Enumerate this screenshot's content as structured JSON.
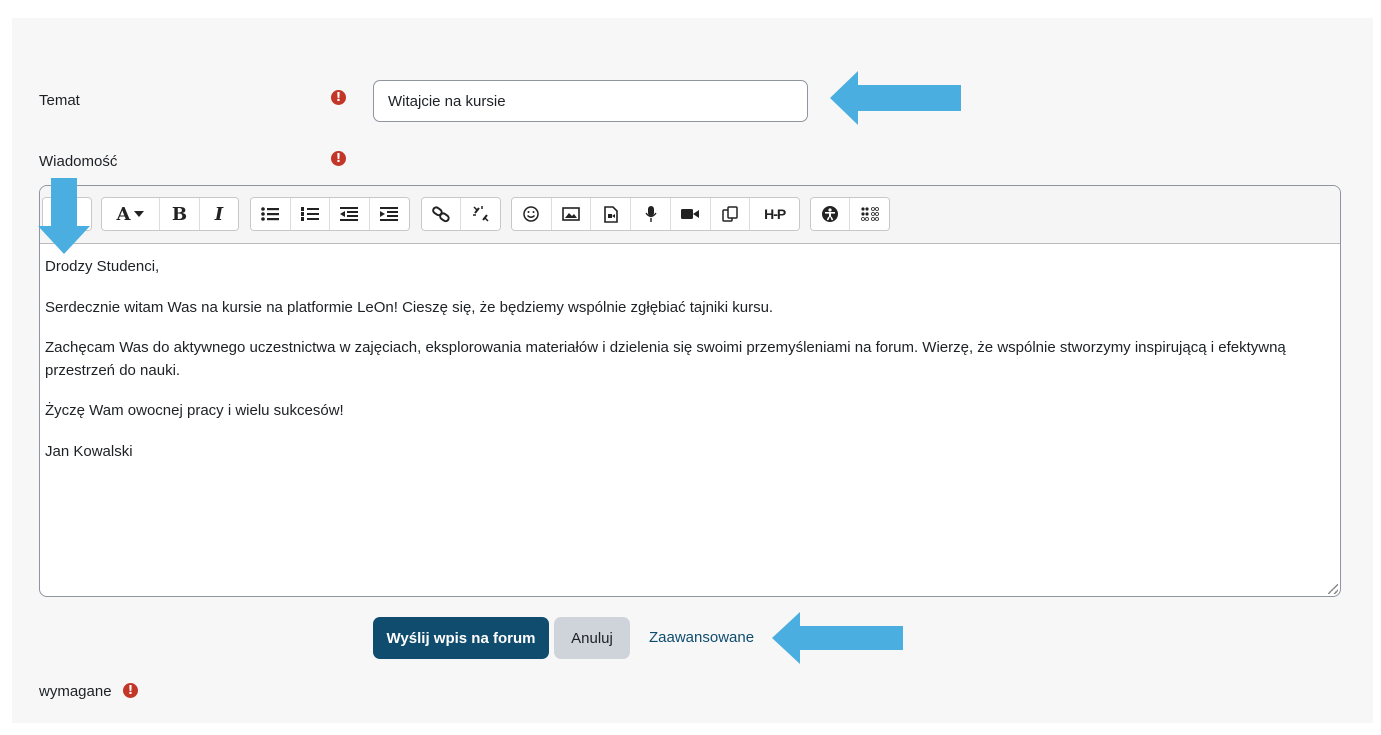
{
  "form": {
    "subject_label": "Temat",
    "subject_value": "Witajcie na kursie",
    "message_label": "Wiadomość",
    "required_label": "wymagane",
    "required_icon": "exclamation-circle-icon",
    "required_color": "#c23728"
  },
  "toolbar": {
    "groups": [
      [
        "collapse-toggle"
      ],
      [
        "font-style-dropdown",
        "bold",
        "italic"
      ],
      [
        "unordered-list",
        "ordered-list",
        "outdent",
        "indent"
      ],
      [
        "link",
        "unlink"
      ],
      [
        "emoji",
        "image",
        "media",
        "record-audio",
        "record-video",
        "manage-files",
        "h5p"
      ],
      [
        "accessibility-checker",
        "screenreader-helper"
      ]
    ],
    "font_style_label": "A",
    "bold_label": "B",
    "italic_label": "I",
    "h5p_label": "H-P"
  },
  "message": {
    "paragraphs": [
      "Drodzy Studenci,",
      "Serdecznie witam Was na kursie na platformie LeOn! Cieszę się, że będziemy wspólnie zgłębiać tajniki kursu.",
      "Zachęcam Was do aktywnego uczestnictwa w zajęciach, eksplorowania materiałów i dzielenia się swoimi przemyśleniami na forum. Wierzę, że wspólnie stworzymy inspirującą i efektywną przestrzeń do nauki.",
      "Życzę Wam owocnej pracy i wielu sukcesów!",
      "Jan Kowalski"
    ]
  },
  "actions": {
    "submit_label": "Wyślij wpis na forum",
    "cancel_label": "Anuluj",
    "advanced_label": "Zaawansowane"
  },
  "colors": {
    "accent": "#0f4c6e",
    "annotation_arrow": "#4aaee0",
    "panel_bg": "#f7f7f7"
  }
}
